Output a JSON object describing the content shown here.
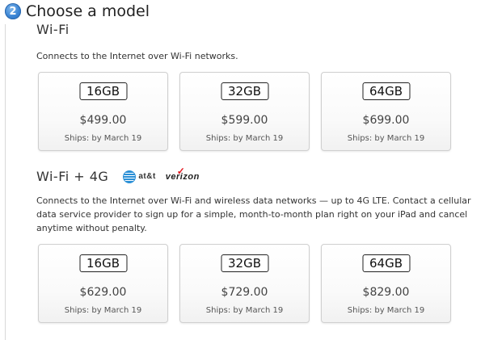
{
  "step": {
    "number": "2",
    "title": "Choose a model"
  },
  "sections": [
    {
      "title": "Wi‑Fi",
      "description": "Connects to the Internet over Wi‑Fi networks.",
      "models": [
        {
          "capacity": "16GB",
          "price": "$499.00",
          "ships": "Ships: by March 19"
        },
        {
          "capacity": "32GB",
          "price": "$599.00",
          "ships": "Ships: by March 19"
        },
        {
          "capacity": "64GB",
          "price": "$699.00",
          "ships": "Ships: by March 19"
        }
      ]
    },
    {
      "title": "Wi‑Fi + 4G",
      "carriers": {
        "att": "at&t",
        "verizon": "verizon"
      },
      "description": "Connects to the Internet over Wi‑Fi and wireless data networks — up to 4G LTE. Contact a cellular data service provider to sign up for a simple, month-to-month plan right on your iPad and cancel anytime without penalty.",
      "models": [
        {
          "capacity": "16GB",
          "price": "$629.00",
          "ships": "Ships: by March 19"
        },
        {
          "capacity": "32GB",
          "price": "$729.00",
          "ships": "Ships: by March 19"
        },
        {
          "capacity": "64GB",
          "price": "$829.00",
          "ships": "Ships: by March 19"
        }
      ]
    }
  ],
  "colors": {
    "step_badge": "#3a84d4",
    "verizon_check": "#e3131b",
    "att_globe": "#2a8fd6"
  }
}
